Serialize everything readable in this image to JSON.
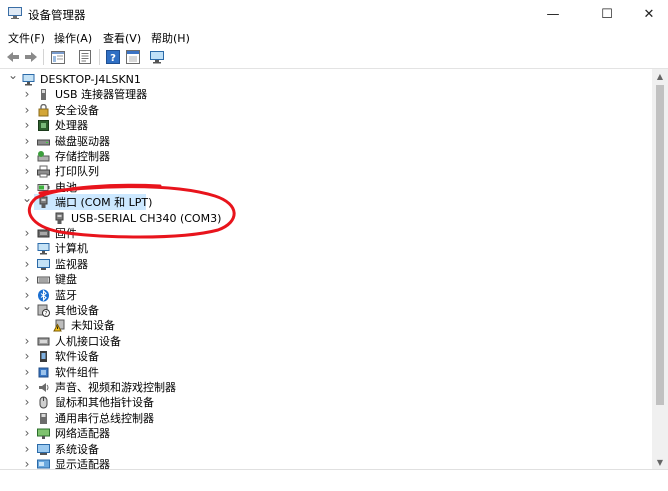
{
  "window": {
    "title": "设备管理器",
    "minimize_icon": "minimize-icon",
    "maximize_icon": "maximize-icon",
    "close_icon": "close-icon",
    "minimize_glyph": "—",
    "maximize_glyph": "☐",
    "close_glyph": "✕"
  },
  "menu": {
    "file": "文件(F)",
    "action": "操作(A)",
    "view": "查看(V)",
    "help": "帮助(H)"
  },
  "toolbar": {
    "icons": [
      "back-arrow-icon",
      "forward-arrow-icon",
      "properties-panel-icon",
      "document-icon",
      "help-icon",
      "show-hidden-icon",
      "monitor-scan-icon"
    ]
  },
  "tree": {
    "root": "DESKTOP-J4LSKN1",
    "items": [
      {
        "label": "USB 连接器管理器",
        "icon": "usb-connector-icon",
        "expanded": false
      },
      {
        "label": "安全设备",
        "icon": "security-device-icon",
        "expanded": false
      },
      {
        "label": "处理器",
        "icon": "processor-icon",
        "expanded": false
      },
      {
        "label": "磁盘驱动器",
        "icon": "disk-drive-icon",
        "expanded": false
      },
      {
        "label": "存储控制器",
        "icon": "storage-controller-icon",
        "expanded": false
      },
      {
        "label": "打印队列",
        "icon": "printer-icon",
        "expanded": false
      },
      {
        "label": "电池",
        "icon": "battery-icon",
        "expanded": false
      },
      {
        "label": "端口 (COM 和 LPT)",
        "icon": "port-icon",
        "expanded": true,
        "selected": true,
        "children": [
          {
            "label": "USB-SERIAL CH340 (COM3)",
            "icon": "port-icon"
          }
        ]
      },
      {
        "label": "固件",
        "icon": "firmware-icon",
        "expanded": false
      },
      {
        "label": "计算机",
        "icon": "computer-icon",
        "expanded": false
      },
      {
        "label": "监视器",
        "icon": "monitor-icon",
        "expanded": false
      },
      {
        "label": "键盘",
        "icon": "keyboard-icon",
        "expanded": false
      },
      {
        "label": "蓝牙",
        "icon": "bluetooth-icon",
        "expanded": false
      },
      {
        "label": "其他设备",
        "icon": "other-devices-icon",
        "expanded": true,
        "children": [
          {
            "label": "未知设备",
            "icon": "unknown-device-warning-icon"
          }
        ]
      },
      {
        "label": "人机接口设备",
        "icon": "hid-icon",
        "expanded": false
      },
      {
        "label": "软件设备",
        "icon": "software-device-icon",
        "expanded": false
      },
      {
        "label": "软件组件",
        "icon": "software-component-icon",
        "expanded": false
      },
      {
        "label": "声音、视频和游戏控制器",
        "icon": "sound-icon",
        "expanded": false
      },
      {
        "label": "鼠标和其他指针设备",
        "icon": "mouse-icon",
        "expanded": false
      },
      {
        "label": "通用串行总线控制器",
        "icon": "usb-controller-icon",
        "expanded": false
      },
      {
        "label": "网络适配器",
        "icon": "network-adapter-icon",
        "expanded": false
      },
      {
        "label": "系统设备",
        "icon": "system-device-icon",
        "expanded": false
      },
      {
        "label": "显示适配器",
        "icon": "display-adapter-icon",
        "expanded": false
      }
    ]
  },
  "colors": {
    "selection": "#cce8ff",
    "annotation": "#e8141c"
  }
}
